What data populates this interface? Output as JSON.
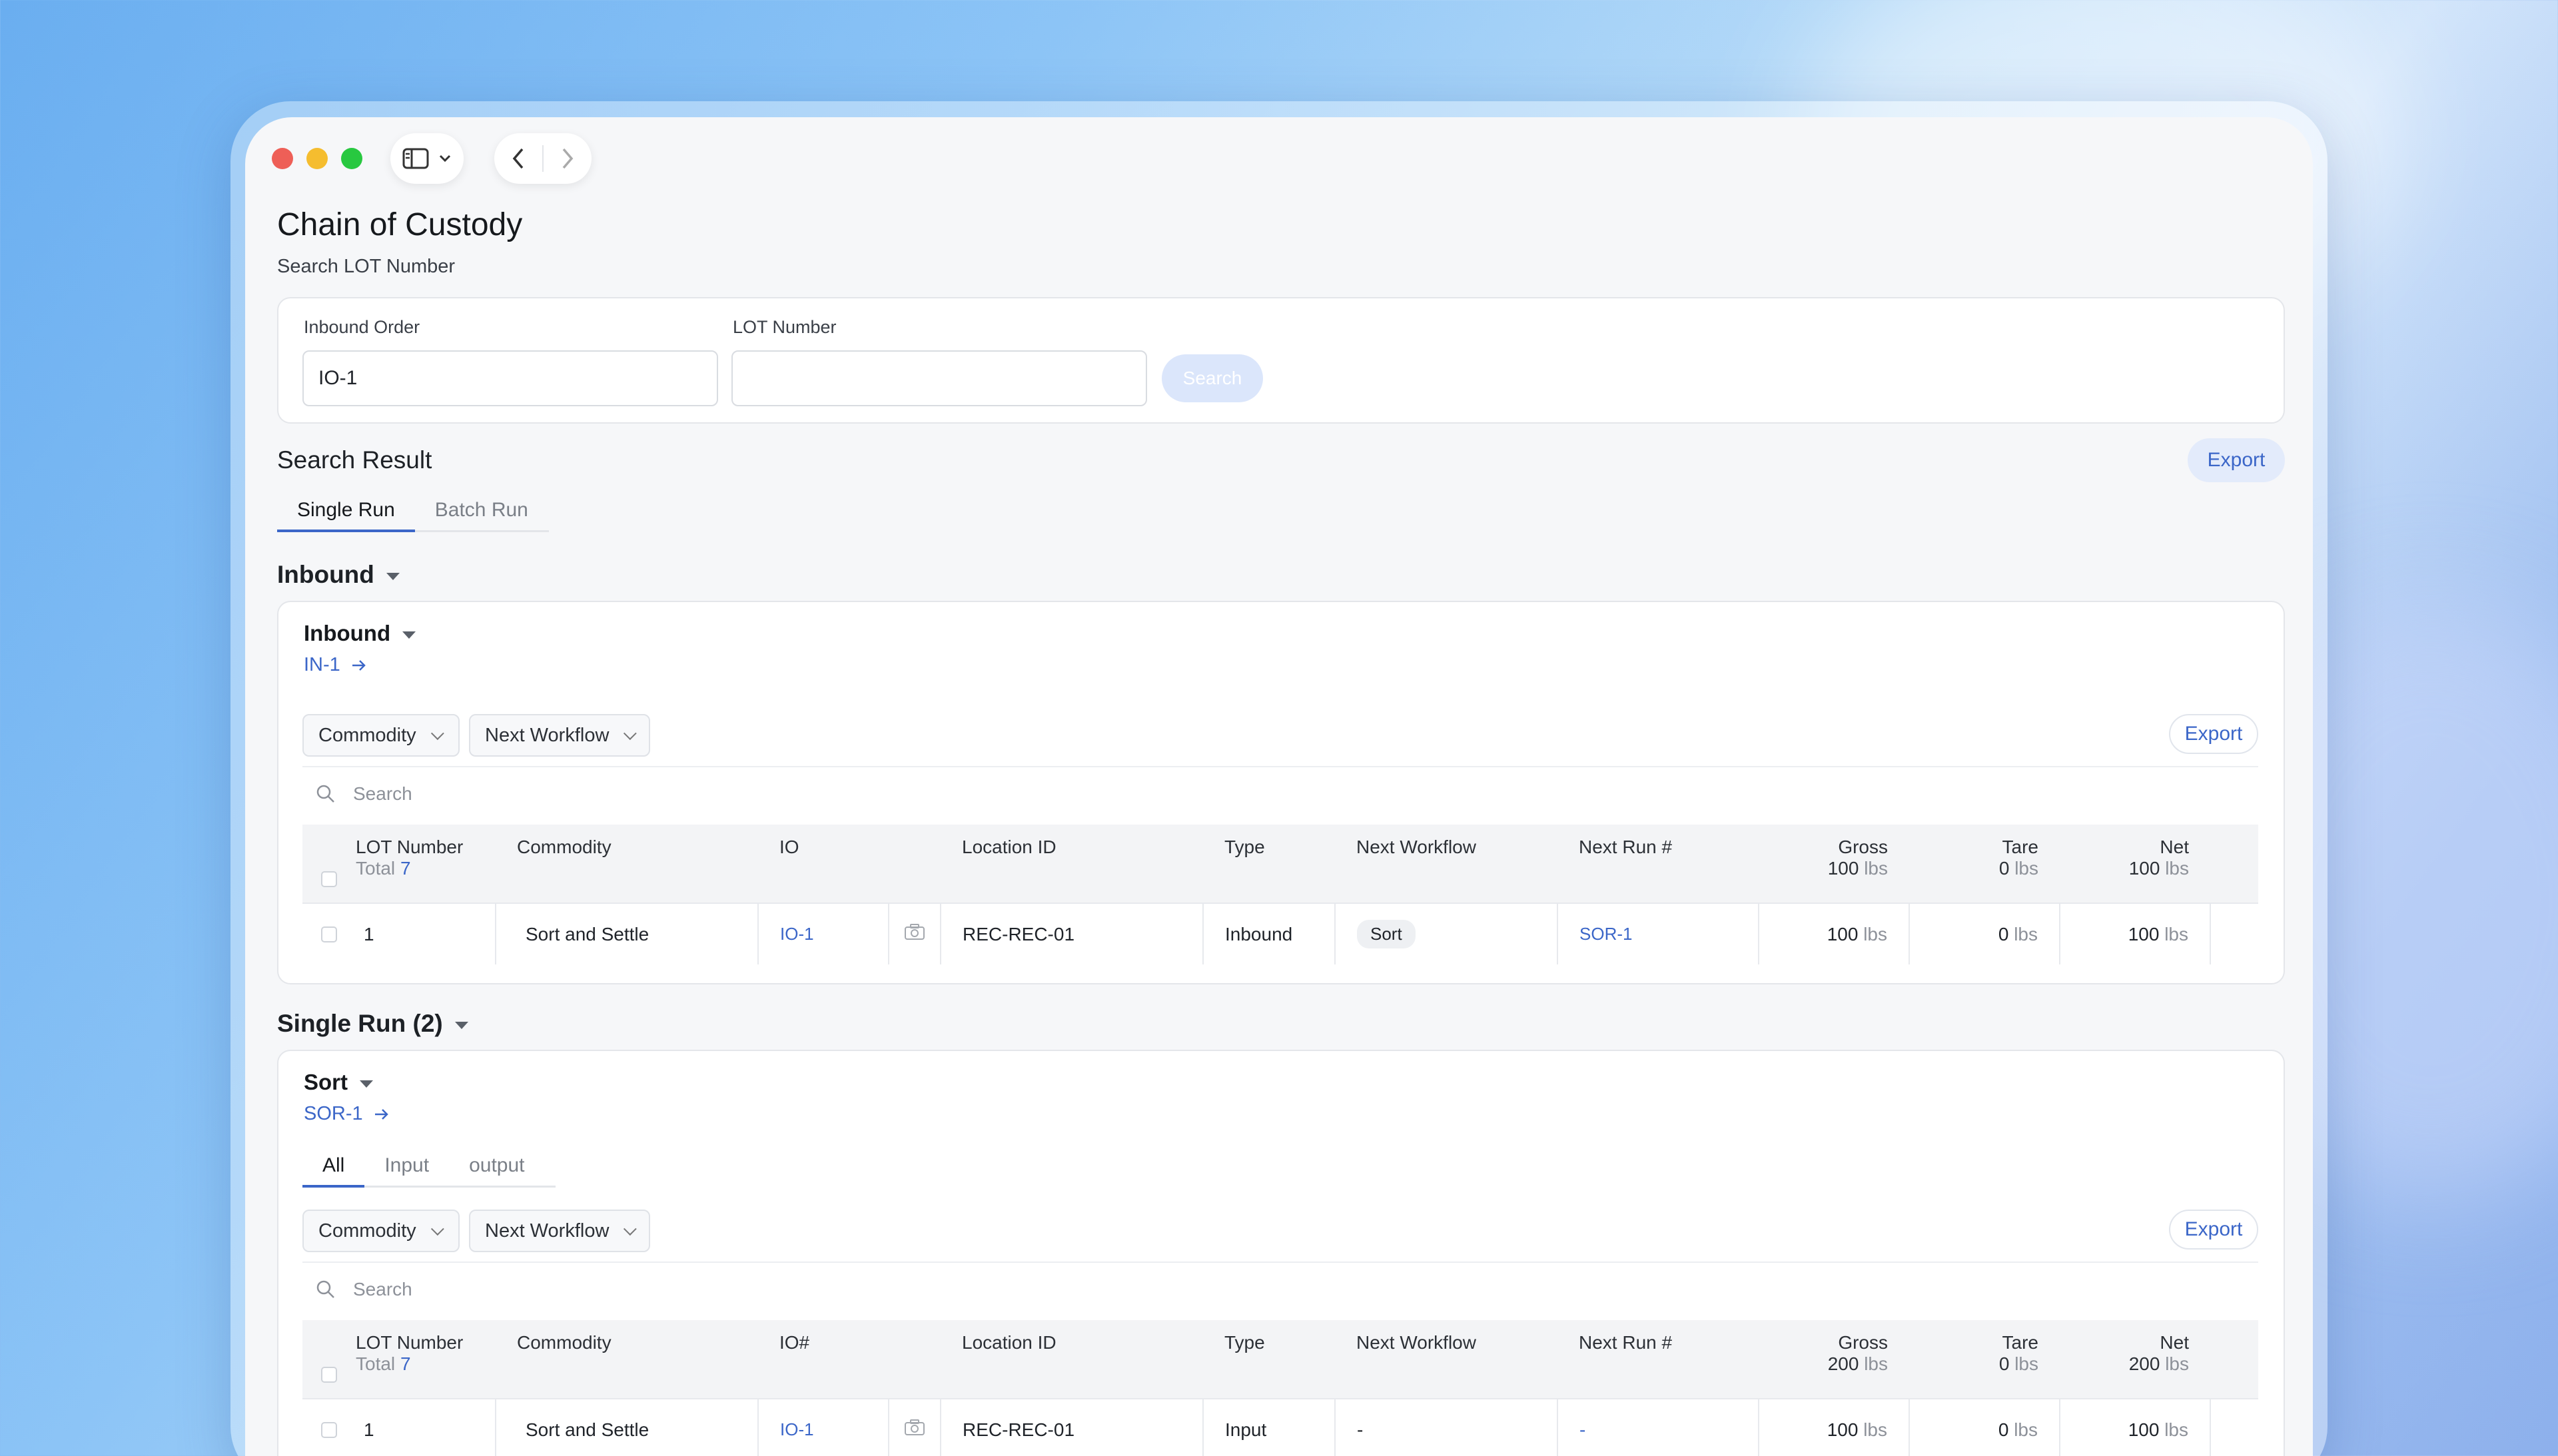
{
  "page": {
    "title": "Chain of Custody",
    "subtitle": "Search LOT Number"
  },
  "search_form": {
    "inbound_order_label": "Inbound Order",
    "inbound_order_value": "IO-1",
    "lot_number_label": "LOT Number",
    "lot_number_value": "",
    "search_label": "Search"
  },
  "results": {
    "title": "Search Result",
    "export_label": "Export",
    "tabs": [
      {
        "label": "Single Run"
      },
      {
        "label": "Batch Run"
      }
    ]
  },
  "inbound_section": {
    "title": "Inbound",
    "card_title": "Inbound",
    "link": "IN-1",
    "filters": [
      "Commodity",
      "Next Workflow"
    ],
    "export_label": "Export",
    "search_placeholder": "Search",
    "columns": {
      "lot": "LOT Number",
      "total_label": "Total",
      "total_value": "7",
      "commodity": "Commodity",
      "io": "IO",
      "location": "Location ID",
      "type": "Type",
      "next_workflow": "Next Workflow",
      "next_run": "Next Run #",
      "gross": "Gross",
      "gross_sum": "100",
      "tare": "Tare",
      "tare_sum": "0",
      "net": "Net",
      "net_sum": "100",
      "unit": "lbs"
    },
    "rows": [
      {
        "lot": "1",
        "commodity": "Sort and Settle",
        "io": "IO-1",
        "location": "REC-REC-01",
        "type": "Inbound",
        "next_workflow": "Sort",
        "next_run": "SOR-1",
        "gross": "100",
        "tare": "0",
        "net": "100"
      }
    ]
  },
  "single_run_section": {
    "title": "Single Run (2)",
    "card_title": "Sort",
    "link": "SOR-1",
    "tabs": [
      {
        "label": "All"
      },
      {
        "label": "Input"
      },
      {
        "label": "output"
      }
    ],
    "filters": [
      "Commodity",
      "Next Workflow"
    ],
    "export_label": "Export",
    "search_placeholder": "Search",
    "columns": {
      "lot": "LOT Number",
      "total_label": "Total",
      "total_value": "7",
      "commodity": "Commodity",
      "io": "IO#",
      "location": "Location ID",
      "type": "Type",
      "next_workflow": "Next Workflow",
      "next_run": "Next Run #",
      "gross": "Gross",
      "gross_sum": "200",
      "tare": "Tare",
      "tare_sum": "0",
      "net": "Net",
      "net_sum": "200",
      "unit": "lbs"
    },
    "rows": [
      {
        "lot": "1",
        "commodity": "Sort and Settle",
        "io": "IO-1",
        "location": "REC-REC-01",
        "type": "Input",
        "next_workflow": "-",
        "next_run": "-",
        "gross": "100",
        "tare": "0",
        "net": "100"
      }
    ]
  },
  "colors": {
    "accent": "#3b66c8",
    "close": "#ee5f57",
    "minimize": "#f5bd2f",
    "maximize": "#28c840"
  },
  "icons": [
    "sidebar-icon",
    "chevron-down-icon",
    "back-icon",
    "forward-icon",
    "search-icon",
    "camera-icon",
    "arrow-right-icon",
    "caret-down-icon"
  ]
}
